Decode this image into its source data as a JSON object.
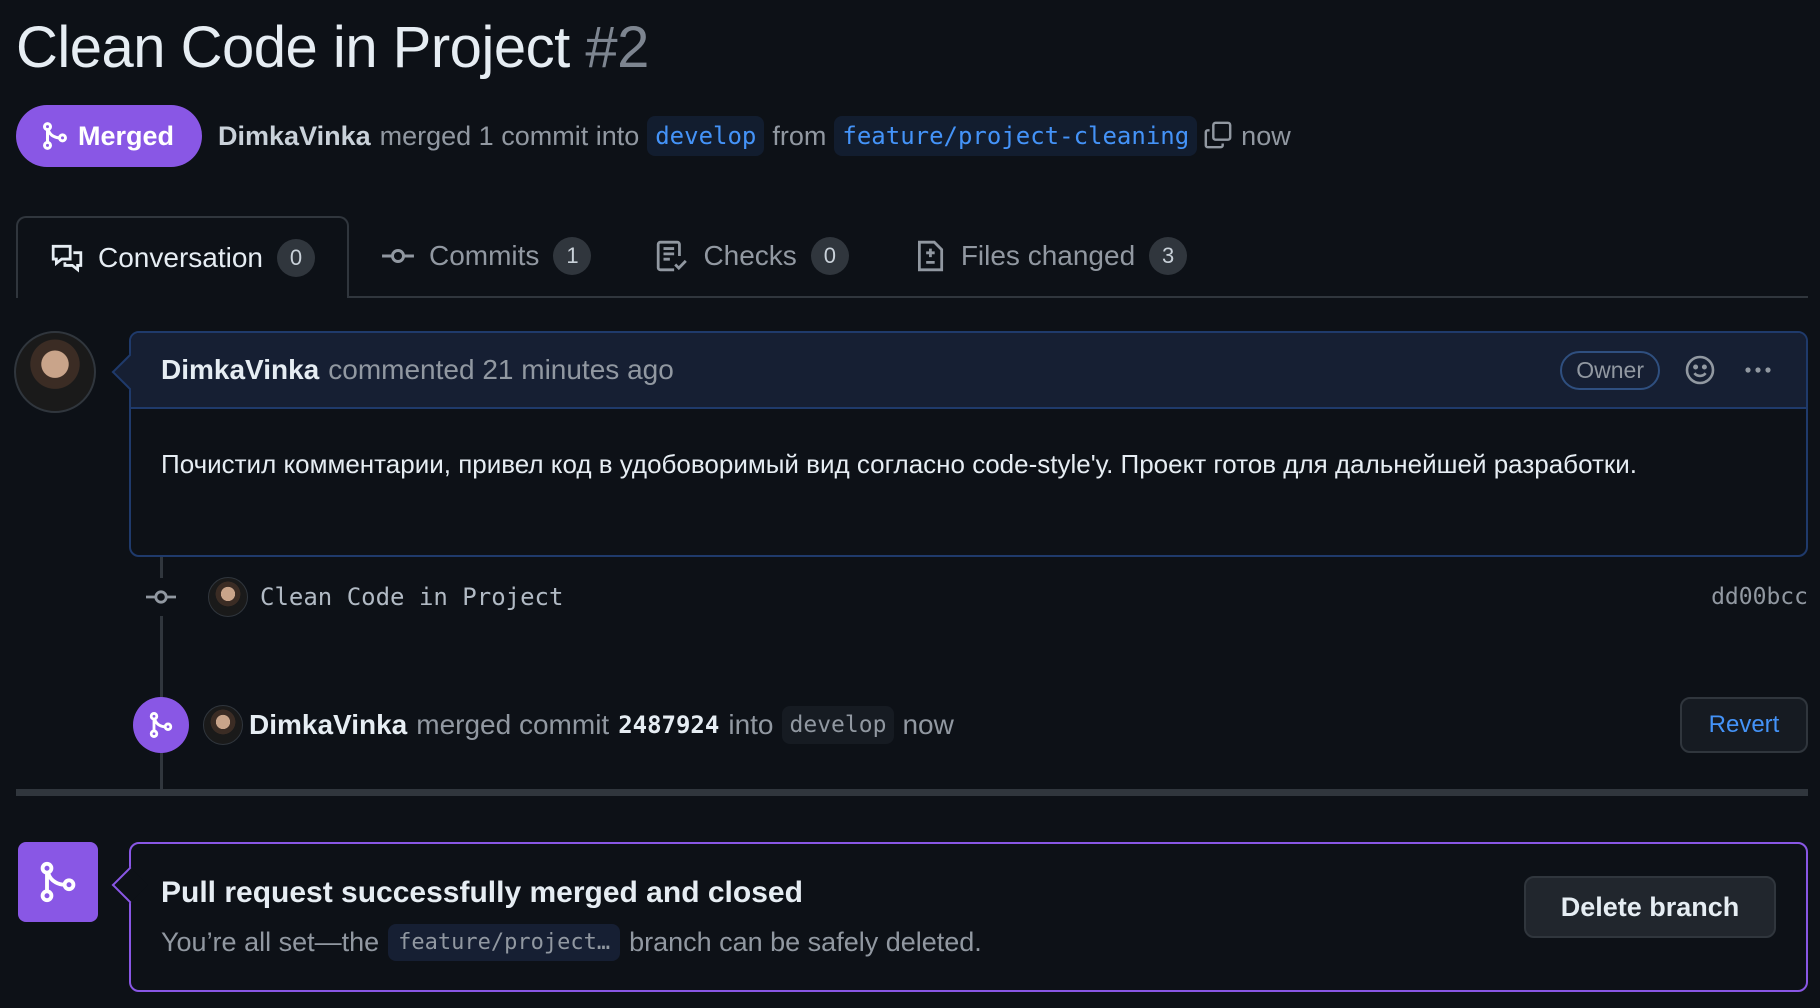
{
  "pr": {
    "title": "Clean Code in Project",
    "number": "#2"
  },
  "status": {
    "state_label": "Merged",
    "author": "DimkaVinka",
    "text_merged": "merged 1 commit into",
    "base_branch": "develop",
    "text_from": "from",
    "head_branch": "feature/project-cleaning",
    "time": "now"
  },
  "tabs": [
    {
      "label": "Conversation",
      "count": "0",
      "icon": "comment-discussion-icon"
    },
    {
      "label": "Commits",
      "count": "1",
      "icon": "git-commit-icon"
    },
    {
      "label": "Checks",
      "count": "0",
      "icon": "checklist-icon"
    },
    {
      "label": "Files changed",
      "count": "3",
      "icon": "file-diff-icon"
    }
  ],
  "comment": {
    "author": "DimkaVinka",
    "meta": "commented 21 minutes ago",
    "badge": "Owner",
    "body": "Почистил комментарии, привел код в удобоворимый вид согласно code-style'у. Проект готов для дальнейшей разработки."
  },
  "commit": {
    "message": "Clean Code in Project",
    "sha": "dd00bcc"
  },
  "merge_event": {
    "author": "DimkaVinka",
    "text_merged": "merged commit",
    "sha": "2487924",
    "text_into": "into",
    "branch": "develop",
    "time": "now",
    "revert_label": "Revert"
  },
  "merged_box": {
    "heading": "Pull request successfully merged and closed",
    "sub_prefix": "You’re all set—the",
    "branch": "feature/project…",
    "sub_suffix": "branch can be safely deleted.",
    "delete_label": "Delete branch"
  },
  "colors": {
    "accent_purple": "#8957e5",
    "link_blue": "#4493f8",
    "background": "#0d1117"
  }
}
